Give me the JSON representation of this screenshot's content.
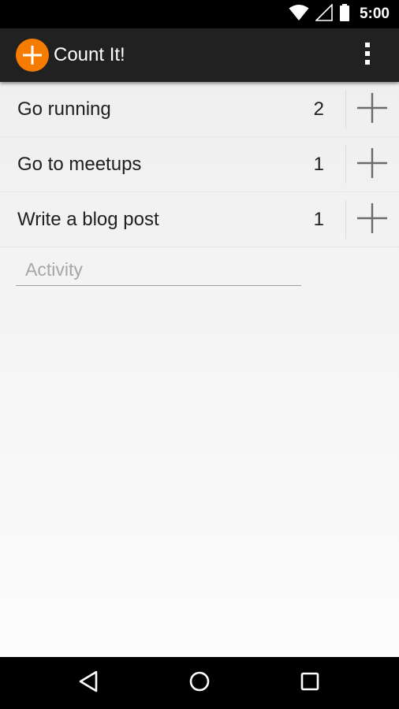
{
  "status_bar": {
    "time": "5:00",
    "icons": [
      "wifi-icon",
      "cell-signal-icon",
      "battery-icon"
    ]
  },
  "app_bar": {
    "title": "Count It!",
    "icon": "plus-circle-icon",
    "accent_color": "#f57c00",
    "overflow_icon": "more-vert-icon"
  },
  "activities": [
    {
      "label": "Go running",
      "count": "2"
    },
    {
      "label": "Go to meetups",
      "count": "1"
    },
    {
      "label": "Write a blog post",
      "count": "1"
    }
  ],
  "new_activity": {
    "placeholder": "Activity",
    "value": ""
  },
  "nav_bar": {
    "icons": [
      "back-icon",
      "home-icon",
      "recents-icon"
    ]
  }
}
